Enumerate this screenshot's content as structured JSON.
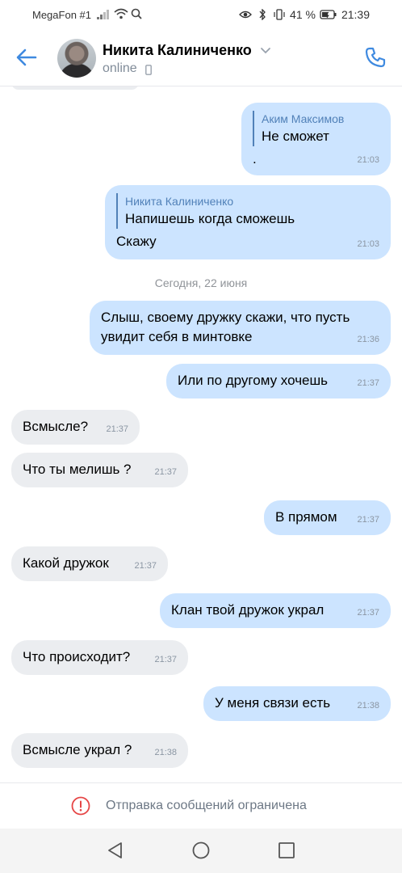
{
  "status_bar": {
    "carrier": "MegaFon #1",
    "battery": "41 %",
    "time": "21:39"
  },
  "header": {
    "contact_name": "Никита Калиниченко",
    "status": "online"
  },
  "messages": [
    {
      "dir": "out",
      "reply_author": "Аким Максимов",
      "reply_text": "Не сможет",
      "text": ".",
      "time": "21:03"
    },
    {
      "dir": "out",
      "reply_author": "Никита Калиниченко",
      "reply_text": "Напишешь когда сможешь",
      "text": "Скажу",
      "time": "21:03"
    },
    {
      "dir": "out",
      "text": "Слыш, своему дружку скажи, что пусть\nувидит себя в минтовке",
      "time": "21:36"
    },
    {
      "dir": "out",
      "text": "Или по другому хочешь",
      "time": "21:37"
    },
    {
      "dir": "in",
      "text": "Всмысле?",
      "time": "21:37"
    },
    {
      "dir": "in",
      "text": "Что ты мелишь ?",
      "time": "21:37"
    },
    {
      "dir": "out",
      "text": "В прямом",
      "time": "21:37"
    },
    {
      "dir": "in",
      "text": "Какой дружок",
      "time": "21:37"
    },
    {
      "dir": "out",
      "text": "Клан твой дружок украл",
      "time": "21:37"
    },
    {
      "dir": "in",
      "text": "Что происходит?",
      "time": "21:37"
    },
    {
      "dir": "out",
      "text": "У меня связи есть",
      "time": "21:38"
    },
    {
      "dir": "in",
      "text": "Всмысле украл ?",
      "time": "21:38"
    }
  ],
  "date_separator": "Сегодня, 22 июня",
  "footer": {
    "restriction_text": "Отправка сообщений ограничена"
  },
  "colors": {
    "accent": "#3f8ae0",
    "outgoing_bubble": "#cce4ff",
    "incoming_bubble": "#ebedf0",
    "warning": "#e64646"
  }
}
